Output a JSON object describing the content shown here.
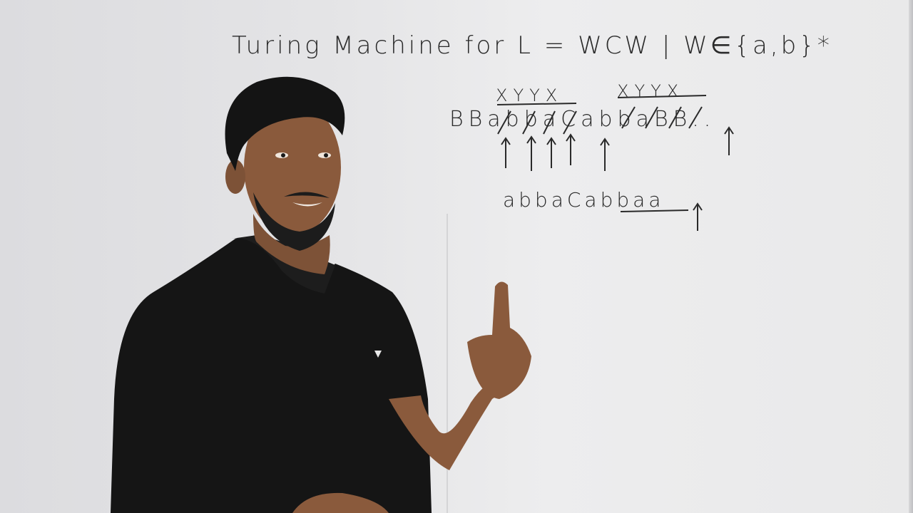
{
  "board": {
    "title": "Turing Machine for L = WCW | W∈{a,b}*",
    "tape_top_left": "XYYX",
    "tape_top_right": "XYYX",
    "tape": "BBabbaCabbaBB..",
    "example": "abbaCabbaa"
  },
  "colors": {
    "ink": "#2a2a2a",
    "shirt": "#151515",
    "skin": "#8a5a3c"
  },
  "icons": [
    "up-arrow-icon"
  ]
}
